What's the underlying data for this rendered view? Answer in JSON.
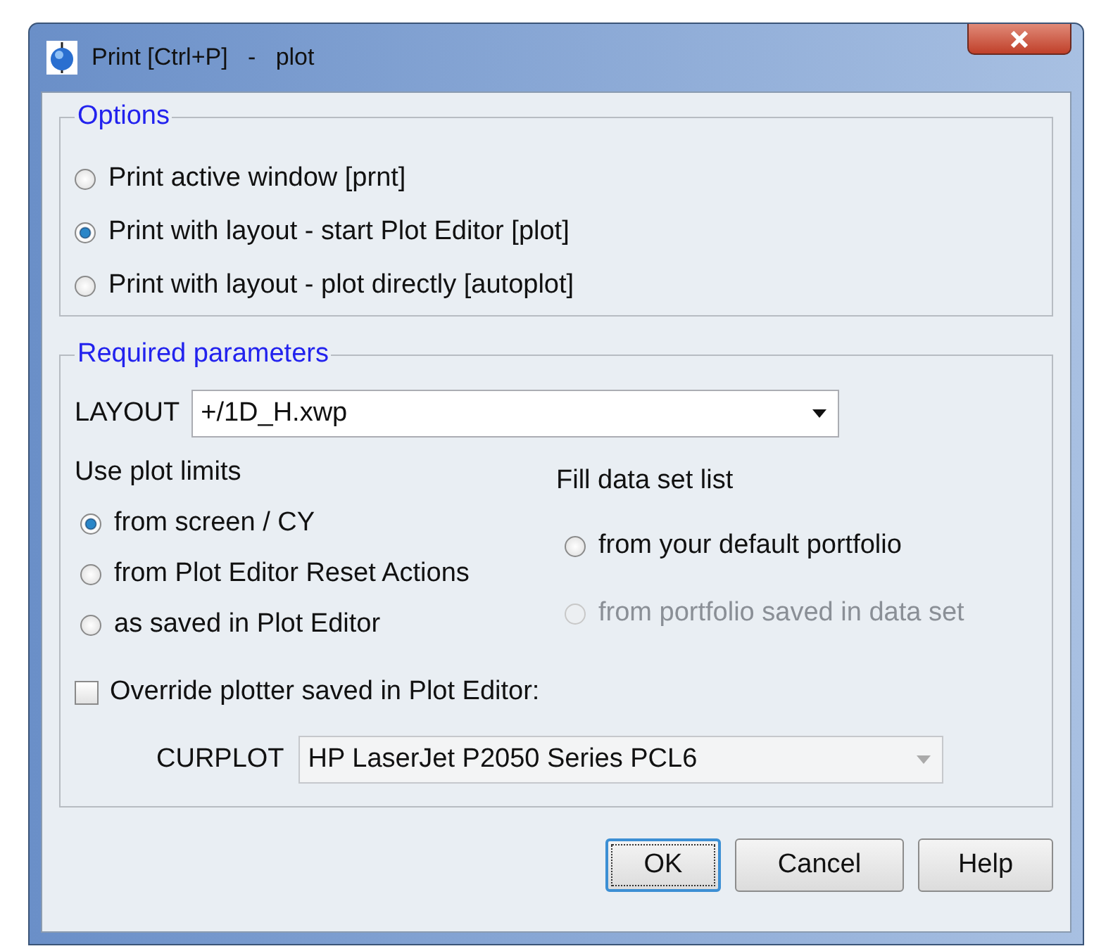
{
  "window": {
    "title": "Print [Ctrl+P]   -   plot"
  },
  "options": {
    "legend": "Options",
    "radios": [
      {
        "label": "Print active window [prnt]",
        "selected": false
      },
      {
        "label": "Print with layout - start Plot Editor [plot]",
        "selected": true
      },
      {
        "label": "Print with layout - plot directly [autoplot]",
        "selected": false
      }
    ]
  },
  "required": {
    "legend": "Required parameters",
    "layout": {
      "label": "LAYOUT",
      "value": "+/1D_H.xwp"
    },
    "plot_limits": {
      "heading": "Use plot limits",
      "radios": [
        {
          "label": "from screen / CY",
          "selected": true
        },
        {
          "label": "from Plot Editor Reset Actions",
          "selected": false
        },
        {
          "label": "as saved in Plot Editor",
          "selected": false
        }
      ]
    },
    "data_set_list": {
      "heading": "Fill data set list",
      "radios": [
        {
          "label": "from your default portfolio",
          "selected": false,
          "disabled": false
        },
        {
          "label": "from portfolio saved in data set",
          "selected": false,
          "disabled": true
        }
      ]
    },
    "override": {
      "label": "Override plotter saved in Plot Editor:",
      "checked": false
    },
    "curplot": {
      "label": "CURPLOT",
      "value": "HP LaserJet P2050 Series PCL6",
      "disabled": true
    }
  },
  "buttons": [
    {
      "label": "OK",
      "focused": true
    },
    {
      "label": "Cancel",
      "focused": false
    },
    {
      "label": "Help",
      "focused": false
    }
  ]
}
